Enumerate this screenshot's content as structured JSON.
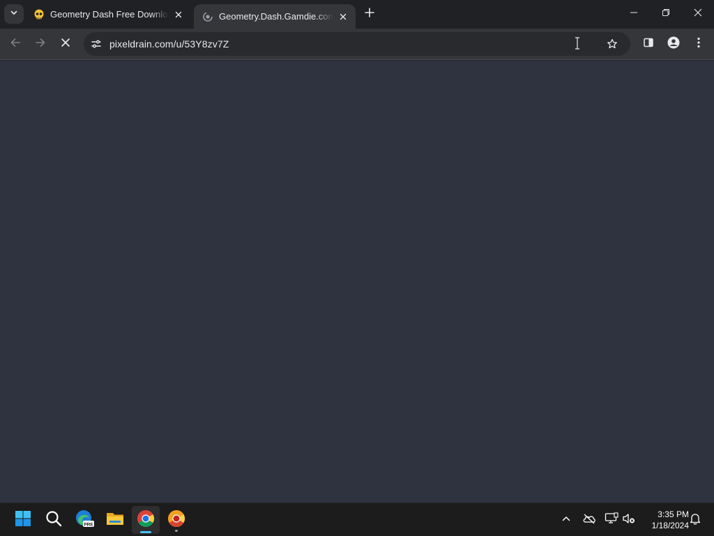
{
  "browser": {
    "tabs": [
      {
        "title": "Geometry Dash Free Download",
        "favicon": "skull-icon",
        "active": false
      },
      {
        "title": "Geometry.Dash.Gamdie.com.zip",
        "favicon": "loading-spinner-icon",
        "active": true
      }
    ],
    "address_bar": {
      "url": "pixeldrain.com/u/53Y8zv7Z"
    },
    "colors": {
      "frame": "#202124",
      "toolbar": "#35363a",
      "omnibox": "#282a2d",
      "page_bg": "#2f3340"
    }
  },
  "taskbar": {
    "apps": [
      "start-icon",
      "search-icon",
      "edge-beta-icon",
      "file-explorer-icon",
      "chrome-icon",
      "chrome-canary-icon"
    ],
    "edge_badge": "PRE",
    "clock": {
      "time": "3:35 PM",
      "date": "1/18/2024"
    }
  }
}
